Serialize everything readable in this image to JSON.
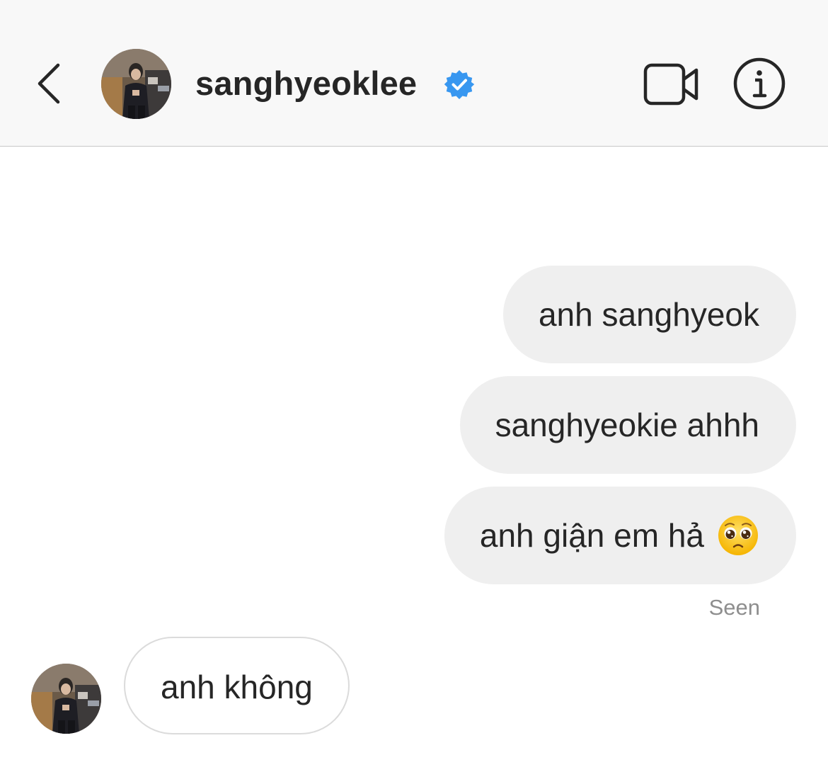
{
  "header": {
    "back_icon": "chevron-left-icon",
    "username": "sanghyeoklee",
    "verified_icon": "verified-badge-icon",
    "video_icon": "video-call-icon",
    "info_icon": "info-icon"
  },
  "messages": [
    {
      "direction": "sent",
      "text": "anh sanghyeok"
    },
    {
      "direction": "sent",
      "text": "sanghyeokie ahhh"
    },
    {
      "direction": "sent",
      "text": "anh giận em hả",
      "emoji": "pleading-face-icon"
    },
    {
      "direction": "received",
      "text": "anh không"
    }
  ],
  "status": {
    "seen_label": "Seen"
  },
  "colors": {
    "header_bg": "#f8f8f8",
    "sent_bubble": "#efefef",
    "received_border": "#dbdbdb",
    "verified_blue": "#3897f0",
    "muted_text": "#8e8e8e",
    "text": "#262626"
  }
}
